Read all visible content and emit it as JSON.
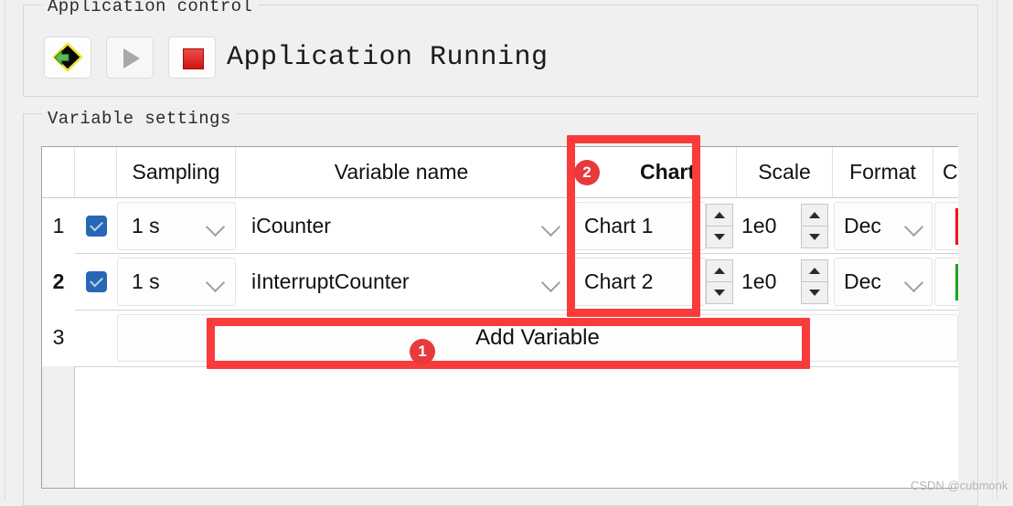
{
  "app": {
    "control_group_title": "Application control",
    "variable_group_title": "Variable settings",
    "status_text": "Application Running",
    "buttons": {
      "download": "download-icon",
      "run": "run-icon",
      "stop": "stop-icon"
    }
  },
  "table": {
    "headers": {
      "rownum": "",
      "enabled": "",
      "sampling": "Sampling",
      "variable_name": "Variable name",
      "chart": "Chart",
      "scale": "Scale",
      "format": "Format",
      "color": "Color"
    },
    "rows": [
      {
        "num": "1",
        "checked": true,
        "sampling": "1 s",
        "variable_name": "iCounter",
        "chart": "Chart 1",
        "scale": "1e0",
        "format": "Dec",
        "color": "#fb0d1b"
      },
      {
        "num": "2",
        "checked": true,
        "sampling": "1 s",
        "variable_name": "iInterruptCounter",
        "chart": "Chart 2",
        "scale": "1e0",
        "format": "Dec",
        "color": "#1fa024"
      }
    ],
    "add_row": {
      "num": "3",
      "label": "Add Variable"
    }
  },
  "annotations": {
    "accent_color": "#f93b3b",
    "badge_color": "#e8393c",
    "markers": [
      {
        "id": "1",
        "target": "Add Variable"
      },
      {
        "id": "2",
        "target": "Chart"
      }
    ]
  },
  "watermark": "CSDN @cubmonk"
}
